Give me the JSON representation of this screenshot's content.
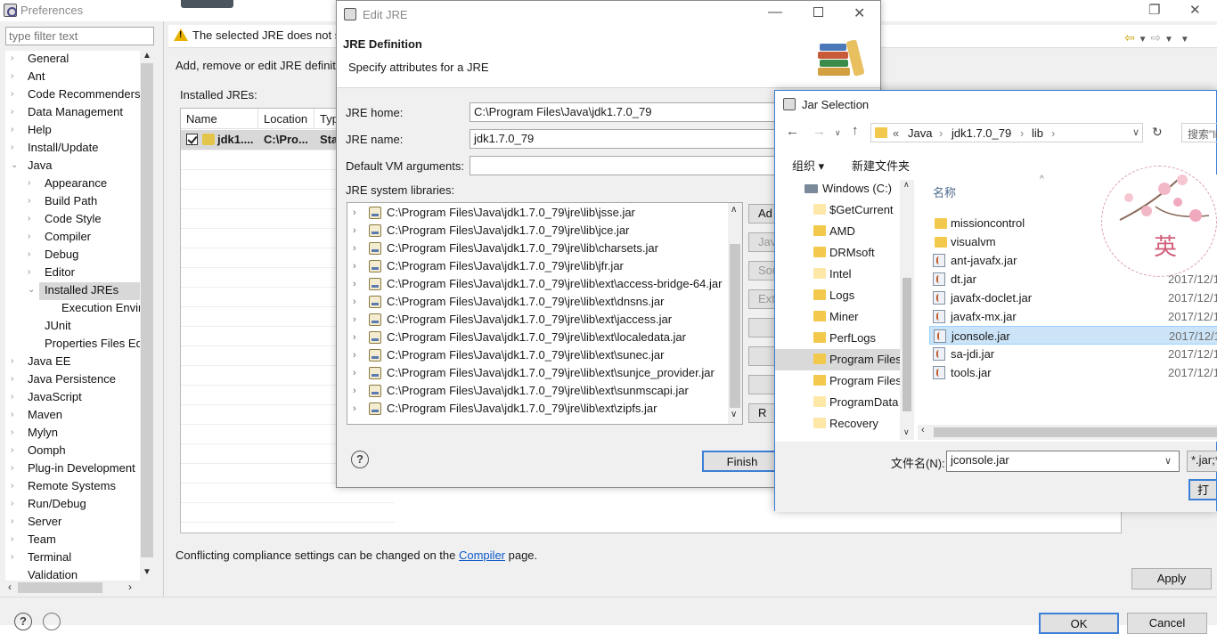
{
  "window": {
    "title": "Preferences",
    "restore_glyph": "❐",
    "close_glyph": "✕"
  },
  "filter": {
    "placeholder": "type filter text"
  },
  "tree": [
    {
      "label": "General",
      "arrow": "›",
      "indent": 0
    },
    {
      "label": "Ant",
      "arrow": "›",
      "indent": 0
    },
    {
      "label": "Code Recommenders",
      "arrow": "›",
      "indent": 0
    },
    {
      "label": "Data Management",
      "arrow": "›",
      "indent": 0
    },
    {
      "label": "Help",
      "arrow": "›",
      "indent": 0
    },
    {
      "label": "Install/Update",
      "arrow": "›",
      "indent": 0
    },
    {
      "label": "Java",
      "arrow": "⌄",
      "indent": 0
    },
    {
      "label": "Appearance",
      "arrow": "›",
      "indent": 1
    },
    {
      "label": "Build Path",
      "arrow": "›",
      "indent": 1
    },
    {
      "label": "Code Style",
      "arrow": "›",
      "indent": 1
    },
    {
      "label": "Compiler",
      "arrow": "›",
      "indent": 1
    },
    {
      "label": "Debug",
      "arrow": "›",
      "indent": 1
    },
    {
      "label": "Editor",
      "arrow": "›",
      "indent": 1
    },
    {
      "label": "Installed JREs",
      "arrow": "⌄",
      "indent": 1
    },
    {
      "label": "Execution Envir",
      "arrow": "",
      "indent": 2
    },
    {
      "label": "JUnit",
      "arrow": "",
      "indent": 1
    },
    {
      "label": "Properties Files Ed",
      "arrow": "",
      "indent": 1
    },
    {
      "label": "Java EE",
      "arrow": "›",
      "indent": 0
    },
    {
      "label": "Java Persistence",
      "arrow": "›",
      "indent": 0
    },
    {
      "label": "JavaScript",
      "arrow": "›",
      "indent": 0
    },
    {
      "label": "Maven",
      "arrow": "›",
      "indent": 0
    },
    {
      "label": "Mylyn",
      "arrow": "›",
      "indent": 0
    },
    {
      "label": "Oomph",
      "arrow": "›",
      "indent": 0
    },
    {
      "label": "Plug-in Development",
      "arrow": "›",
      "indent": 0
    },
    {
      "label": "Remote Systems",
      "arrow": "›",
      "indent": 0
    },
    {
      "label": "Run/Debug",
      "arrow": "›",
      "indent": 0
    },
    {
      "label": "Server",
      "arrow": "›",
      "indent": 0
    },
    {
      "label": "Team",
      "arrow": "›",
      "indent": 0
    },
    {
      "label": "Terminal",
      "arrow": "›",
      "indent": 0
    },
    {
      "label": "Validation",
      "arrow": "",
      "indent": 0
    }
  ],
  "main": {
    "warning": "The selected JRE does not s",
    "description": "Add, remove or edit JRE definit",
    "installed_label": "Installed JREs:",
    "columns": [
      "Name",
      "Location",
      "Typ"
    ],
    "row": {
      "name": "jdk1....",
      "location": "C:\\Pro...",
      "type": "Sta"
    },
    "footer_prefix": "Conflicting compliance settings can be changed on the ",
    "footer_link": "Compiler",
    "footer_suffix": " page.",
    "apply_label": "Apply",
    "ok_label": "OK",
    "cancel_label": "Cancel"
  },
  "edit_jre": {
    "title": "Edit JRE",
    "heading": "JRE Definition",
    "subheading": "Specify attributes for a JRE",
    "home_label": "JRE home:",
    "home_value": "C:\\Program Files\\Java\\jdk1.7.0_79",
    "name_label": "JRE name:",
    "name_value": "jdk1.7.0_79",
    "vmargs_label": "Default VM arguments:",
    "vmargs_value": "",
    "libs_label": "JRE system libraries:",
    "libraries": [
      "C:\\Program Files\\Java\\jdk1.7.0_79\\jre\\lib\\jsse.jar",
      "C:\\Program Files\\Java\\jdk1.7.0_79\\jre\\lib\\jce.jar",
      "C:\\Program Files\\Java\\jdk1.7.0_79\\jre\\lib\\charsets.jar",
      "C:\\Program Files\\Java\\jdk1.7.0_79\\jre\\lib\\jfr.jar",
      "C:\\Program Files\\Java\\jdk1.7.0_79\\jre\\lib\\ext\\access-bridge-64.jar",
      "C:\\Program Files\\Java\\jdk1.7.0_79\\jre\\lib\\ext\\dnsns.jar",
      "C:\\Program Files\\Java\\jdk1.7.0_79\\jre\\lib\\ext\\jaccess.jar",
      "C:\\Program Files\\Java\\jdk1.7.0_79\\jre\\lib\\ext\\localedata.jar",
      "C:\\Program Files\\Java\\jdk1.7.0_79\\jre\\lib\\ext\\sunec.jar",
      "C:\\Program Files\\Java\\jdk1.7.0_79\\jre\\lib\\ext\\sunjce_provider.jar",
      "C:\\Program Files\\Java\\jdk1.7.0_79\\jre\\lib\\ext\\sunmscapi.jar",
      "C:\\Program Files\\Java\\jdk1.7.0_79\\jre\\lib\\ext\\zipfs.jar"
    ],
    "side_buttons": [
      "Ad",
      "Jav",
      "Sou",
      "Exte",
      "",
      "",
      "",
      "R"
    ],
    "finish_label": "Finish"
  },
  "jar_selection": {
    "title": "Jar Selection",
    "breadcrumb": [
      "«",
      "Java",
      "jdk1.7.0_79",
      "lib"
    ],
    "search_placeholder": "搜索\"li",
    "organize_label": "组织 ▾",
    "new_folder_label": "新建文件夹",
    "name_column": "名称",
    "nav_items": [
      {
        "label": "Windows (C:)",
        "type": "drive"
      },
      {
        "label": "$GetCurrent",
        "type": "folder-light"
      },
      {
        "label": "AMD",
        "type": "folder"
      },
      {
        "label": "DRMsoft",
        "type": "folder"
      },
      {
        "label": "Intel",
        "type": "folder-light"
      },
      {
        "label": "Logs",
        "type": "folder"
      },
      {
        "label": "Miner",
        "type": "folder"
      },
      {
        "label": "PerfLogs",
        "type": "folder"
      },
      {
        "label": "Program Files",
        "type": "folder",
        "selected": true
      },
      {
        "label": "Program Files",
        "type": "folder"
      },
      {
        "label": "ProgramData",
        "type": "folder-light"
      },
      {
        "label": "Recovery",
        "type": "folder-light"
      }
    ],
    "files": [
      {
        "name": "missioncontrol",
        "type": "folder",
        "date": ""
      },
      {
        "name": "visualvm",
        "type": "folder",
        "date": ""
      },
      {
        "name": "ant-javafx.jar",
        "type": "jar",
        "date": ""
      },
      {
        "name": "dt.jar",
        "type": "jar",
        "date": "2017/12/1"
      },
      {
        "name": "javafx-doclet.jar",
        "type": "jar",
        "date": "2017/12/1"
      },
      {
        "name": "javafx-mx.jar",
        "type": "jar",
        "date": "2017/12/1"
      },
      {
        "name": "jconsole.jar",
        "type": "jar",
        "date": "2017/12/1",
        "selected": true
      },
      {
        "name": "sa-jdi.jar",
        "type": "jar",
        "date": "2017/12/1"
      },
      {
        "name": "tools.jar",
        "type": "jar",
        "date": "2017/12/1"
      }
    ],
    "filename_label": "文件名(N):",
    "filename_value": "jconsole.jar",
    "filter_value": "*.jar;*",
    "open_label": "打"
  },
  "stamp": {
    "character": "英"
  },
  "colors": {
    "accent": "#3c7fd6",
    "selection": "#cce4f7",
    "link": "#0a58c9",
    "warning": "#e8b200"
  }
}
